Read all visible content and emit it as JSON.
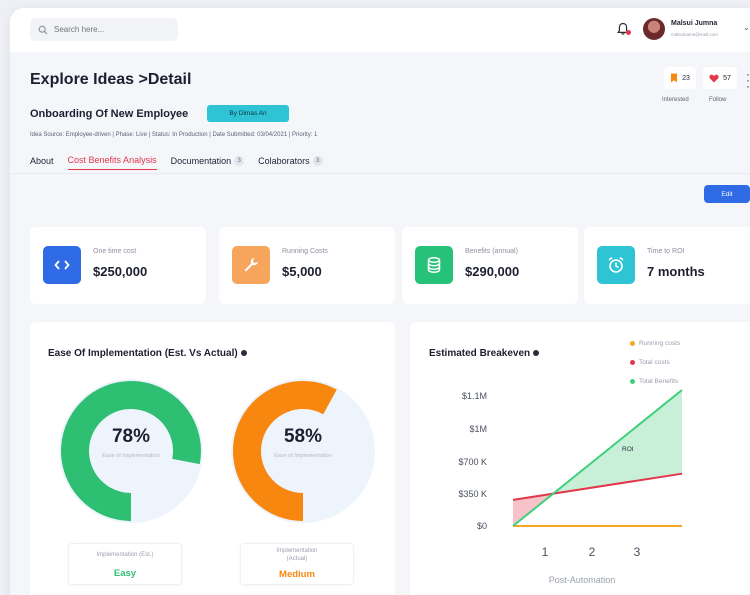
{
  "topbar": {
    "search_placeholder": "Search here...",
    "user_name": "Malsui Jumna",
    "user_email": "malsuiname@mail.com"
  },
  "header": {
    "page_title": "Explore Ideas >Detail",
    "idea_title": "Onboarding Of New Employee",
    "author_badge": "By Dimas Ari",
    "meta": "Idea Source: Employee-driven  |  Phase: Live  |  Status: In Production  |  Date Submitted: 03/04/2021  |  Priority: 1",
    "interested_count": "23",
    "interested_label": "Interested",
    "follow_count": "57",
    "follow_label": "Follow"
  },
  "tabs": [
    {
      "label": "About",
      "count": ""
    },
    {
      "label": "Cost Benefits Analysis",
      "count": ""
    },
    {
      "label": "Documentation",
      "count": "3"
    },
    {
      "label": "Colaborators",
      "count": "3"
    }
  ],
  "edit_label": "Edit",
  "metrics": [
    {
      "label": "One time cost",
      "value": "$250,000",
      "icon": "code-icon",
      "color": "#2f6be4"
    },
    {
      "label": "Running Costs",
      "value": "$5,000",
      "icon": "wrench-icon",
      "color": "#f7a45c"
    },
    {
      "label": "Benefits (annual)",
      "value": "$290,000",
      "icon": "database-icon",
      "color": "#27c27a"
    },
    {
      "label": "Time to ROI",
      "value": "7 months",
      "icon": "alarm-clock-icon",
      "color": "#2ec4d6"
    }
  ],
  "ease": {
    "title": "Ease Of Implementation (Est. Vs Actual)",
    "estimated": {
      "percent": 78,
      "value_text": "78%",
      "center_label": "Ease of Implementation",
      "box_caption": "Implementation (Est.)",
      "level": "Easy",
      "color": "#2fbf73"
    },
    "actual": {
      "percent": 58,
      "value_text": "58%",
      "center_label": "Ease of Implementation",
      "box_caption": "Implementation (Actual)",
      "level": "Medium",
      "color": "#f7870f"
    }
  },
  "breakeven": {
    "title": "Estimated Breakeven",
    "roi_label": "ROI",
    "legend": [
      "Running costs",
      "Total costs",
      "Total Benefits"
    ]
  },
  "chart_data": {
    "type": "line",
    "title": "Estimated Breakeven",
    "xlabel": "Post-Automation",
    "ylabel": "",
    "x": [
      0,
      3.5
    ],
    "xticks": [
      "1",
      "2",
      "3"
    ],
    "yticks": [
      "$0",
      "$350 K",
      "$700 K",
      "$1M",
      "$1.1M"
    ],
    "ylim": [
      0,
      1300000
    ],
    "series": [
      {
        "name": "Running costs",
        "color": "#f5a623",
        "x": [
          0,
          3.5
        ],
        "values": [
          0,
          0
        ]
      },
      {
        "name": "Total costs",
        "color": "#e3374a",
        "x": [
          0,
          3.5
        ],
        "values": [
          250000,
          500000
        ]
      },
      {
        "name": "Total Benefits",
        "color": "#3ecf7c",
        "x": [
          0,
          3.5
        ],
        "values": [
          0,
          1300000
        ]
      }
    ],
    "legend_position": "top-right",
    "grid": false
  }
}
